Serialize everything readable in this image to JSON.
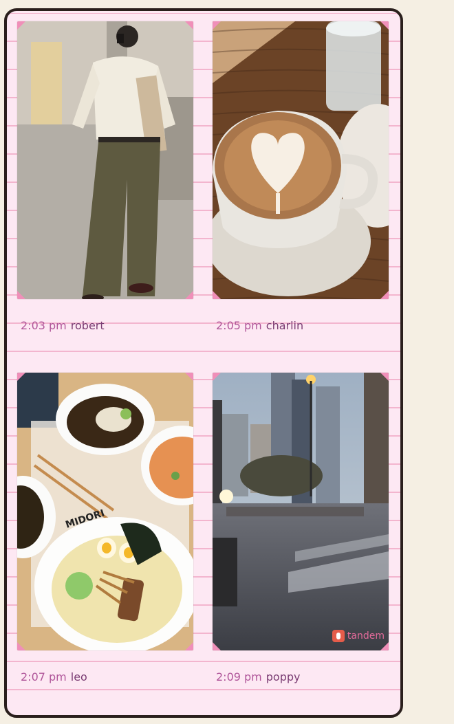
{
  "posts": [
    {
      "time": "2:03 pm",
      "name": "robert",
      "photo": "mirror-selfie"
    },
    {
      "time": "2:05 pm",
      "name": "charlin",
      "photo": "latte-art"
    },
    {
      "time": "2:07 pm",
      "name": "leo",
      "photo": "ramen-bowls"
    },
    {
      "time": "2:09 pm",
      "name": "poppy",
      "photo": "rainy-city-street"
    }
  ],
  "watermark": {
    "label": "tandem",
    "icon": "tandem-logo-icon"
  },
  "colors": {
    "page_bg": "#f5efe3",
    "paper": "#fde8f3",
    "rule_line": "#f3b5ce",
    "corner": "#f08fb9",
    "time_text": "#b0569a",
    "name_text": "#7a3c73",
    "border": "#2a1f1c"
  }
}
